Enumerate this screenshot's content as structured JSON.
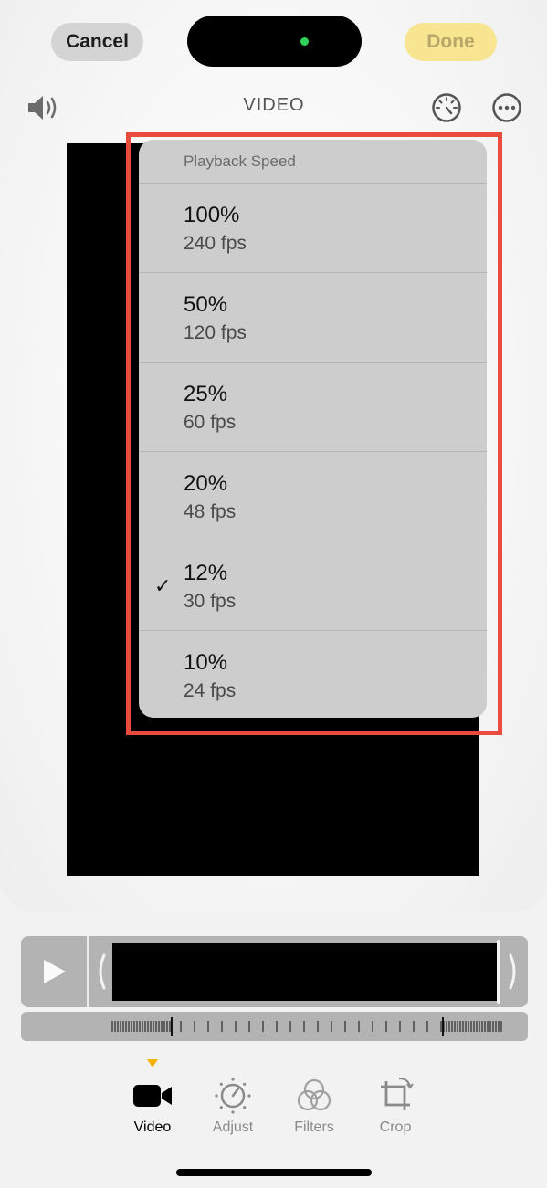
{
  "header": {
    "cancel_label": "Cancel",
    "done_label": "Done",
    "title": "VIDEO",
    "icons": [
      "speaker-icon",
      "playback-speed-icon",
      "more-icon"
    ]
  },
  "speed_menu": {
    "header": "Playback Speed",
    "selected_index": 4,
    "items": [
      {
        "percent": "100%",
        "fps": "240 fps"
      },
      {
        "percent": "50%",
        "fps": "120 fps"
      },
      {
        "percent": "25%",
        "fps": "60 fps"
      },
      {
        "percent": "20%",
        "fps": "48 fps"
      },
      {
        "percent": "12%",
        "fps": "30 fps"
      },
      {
        "percent": "10%",
        "fps": "24 fps"
      }
    ],
    "check_glyph": "✓"
  },
  "tabs": [
    {
      "label": "Video",
      "icon": "video-camera-icon",
      "active": true
    },
    {
      "label": "Adjust",
      "icon": "adjust-dial-icon",
      "active": false
    },
    {
      "label": "Filters",
      "icon": "filters-icon",
      "active": false
    },
    {
      "label": "Crop",
      "icon": "crop-rotate-icon",
      "active": false
    }
  ],
  "colors": {
    "accent_done": "#f7e592",
    "selection_highlight": "#e94b3c",
    "tab_indicator": "#f2b40c",
    "status_dot": "#2fd158"
  }
}
